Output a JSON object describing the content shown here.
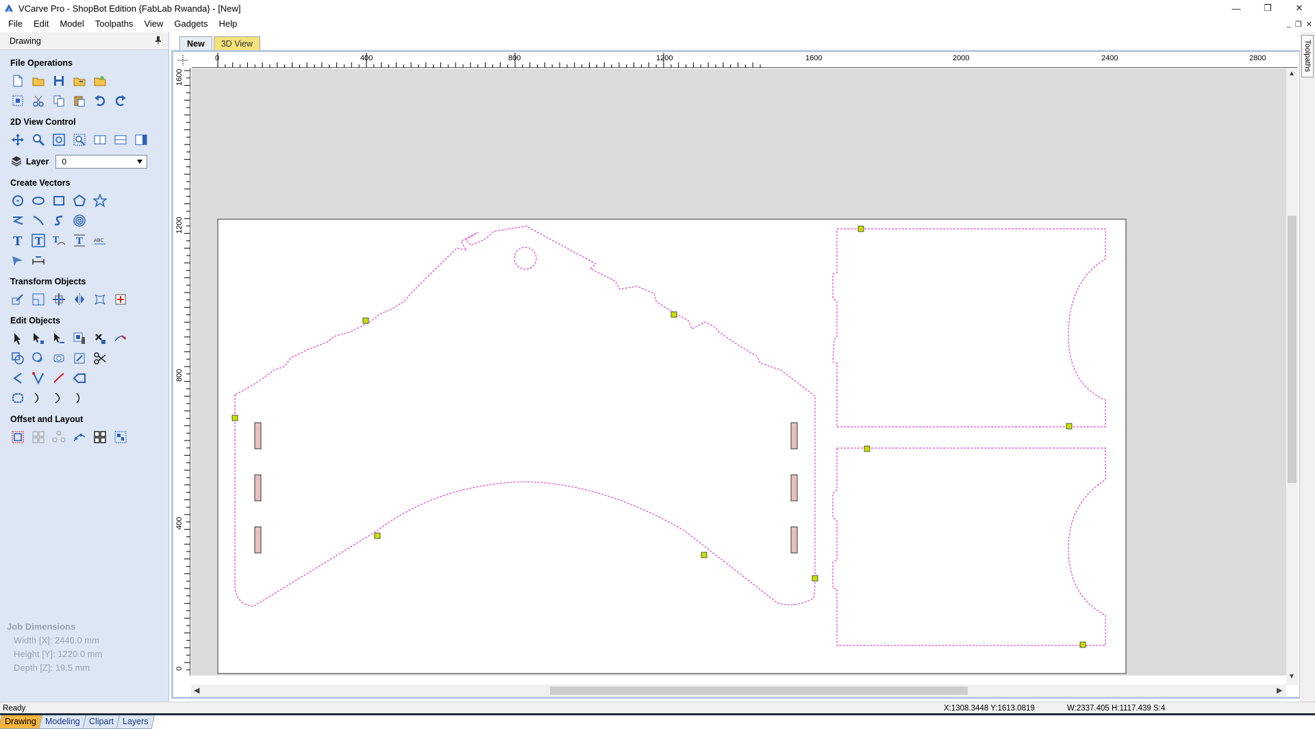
{
  "window": {
    "title": "VCarve Pro - ShopBot Edition {FabLab Rwanda} - [New]",
    "minimize": "—",
    "maximize": "❐",
    "close": "✕"
  },
  "menu": [
    "File",
    "Edit",
    "Model",
    "Toolpaths",
    "View",
    "Gadgets",
    "Help"
  ],
  "mdi": {
    "minimize": "_",
    "restore": "❐",
    "close": "✕"
  },
  "panel": {
    "title": "Drawing",
    "pin": "📌",
    "sections": {
      "file_operations": "File Operations",
      "view_control": "2D View Control",
      "layer_label": "Layer",
      "layer_value": "0",
      "create_vectors": "Create Vectors",
      "transform_objects": "Transform Objects",
      "edit_objects": "Edit Objects",
      "offset_layout": "Offset and Layout"
    },
    "job": {
      "header": "Job Dimensions",
      "width": "Width  [X]: 2440.0 mm",
      "height": "Height [Y]: 1220.0 mm",
      "depth": "Depth  [Z]: 19.5 mm"
    },
    "bottom_tabs": [
      "Drawing",
      "Modeling",
      "Clipart",
      "Layers"
    ]
  },
  "doc_tabs": [
    "New",
    "3D View"
  ],
  "ruler": {
    "top": [
      "0",
      "400",
      "800",
      "1200",
      "1600",
      "2000",
      "2400",
      "2800"
    ],
    "left": [
      "1600",
      "1200",
      "800",
      "400",
      "0"
    ]
  },
  "right_tab": "Toolpaths",
  "status": {
    "ready": "Ready",
    "coords": "X:1308.3448 Y:1613.0819",
    "dims": "W:2337.405  H:1117.439  S:4"
  },
  "colors": {
    "panel_bg": "#dce6f4",
    "vector_line": "#e040d0",
    "active_tab": "#f7b53d",
    "node_marker": "#c7e000"
  }
}
